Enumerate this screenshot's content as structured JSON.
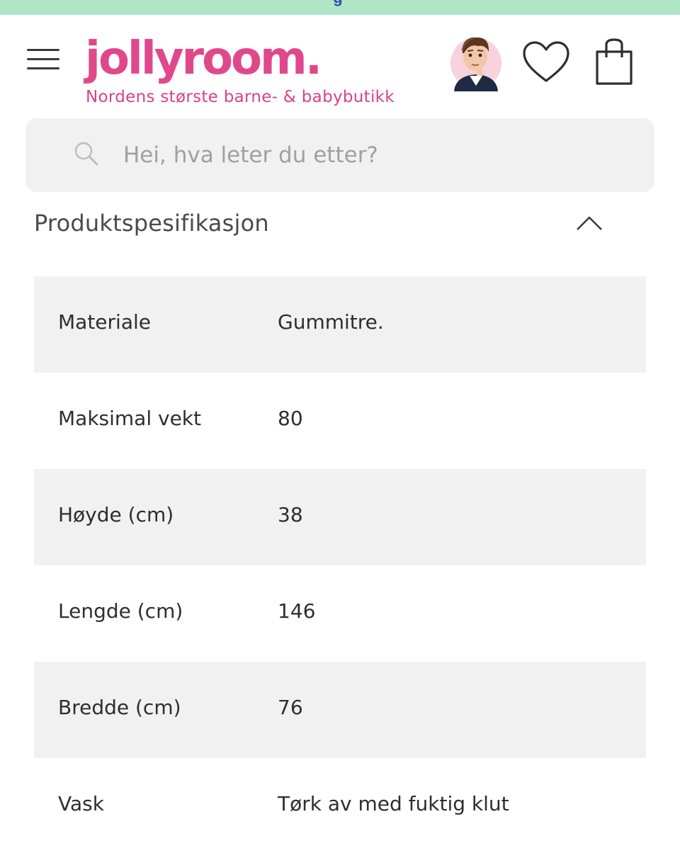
{
  "banner": {
    "text": "g"
  },
  "header": {
    "menu_icon": "hamburger-menu-icon",
    "logo_text": "jollyroom.",
    "tagline": "Nordens største barne- & babybutikk",
    "avatar_icon": "cartoon-assistant-avatar",
    "wishlist_icon": "heart-icon",
    "cart_icon": "shopping-bag-icon",
    "brand_color": "#e0488b"
  },
  "search": {
    "placeholder": "Hei, hva leter du etter?",
    "value": "",
    "icon": "search-icon"
  },
  "spec": {
    "title": "Produktspesifikasjon",
    "toggle_icon": "chevron-up-icon",
    "rows": [
      {
        "label": "Materiale",
        "value": "Gummitre."
      },
      {
        "label": "Maksimal vekt",
        "value": "80"
      },
      {
        "label": "Høyde (cm)",
        "value": "38"
      },
      {
        "label": "Lengde (cm)",
        "value": "146"
      },
      {
        "label": "Bredde (cm)",
        "value": "76"
      },
      {
        "label": "Vask",
        "value": "Tørk av med fuktig klut"
      }
    ]
  },
  "colors": {
    "banner_bg": "#b0e5c7",
    "row_shade": "#f1f1f1",
    "brand": "#e0488b"
  }
}
